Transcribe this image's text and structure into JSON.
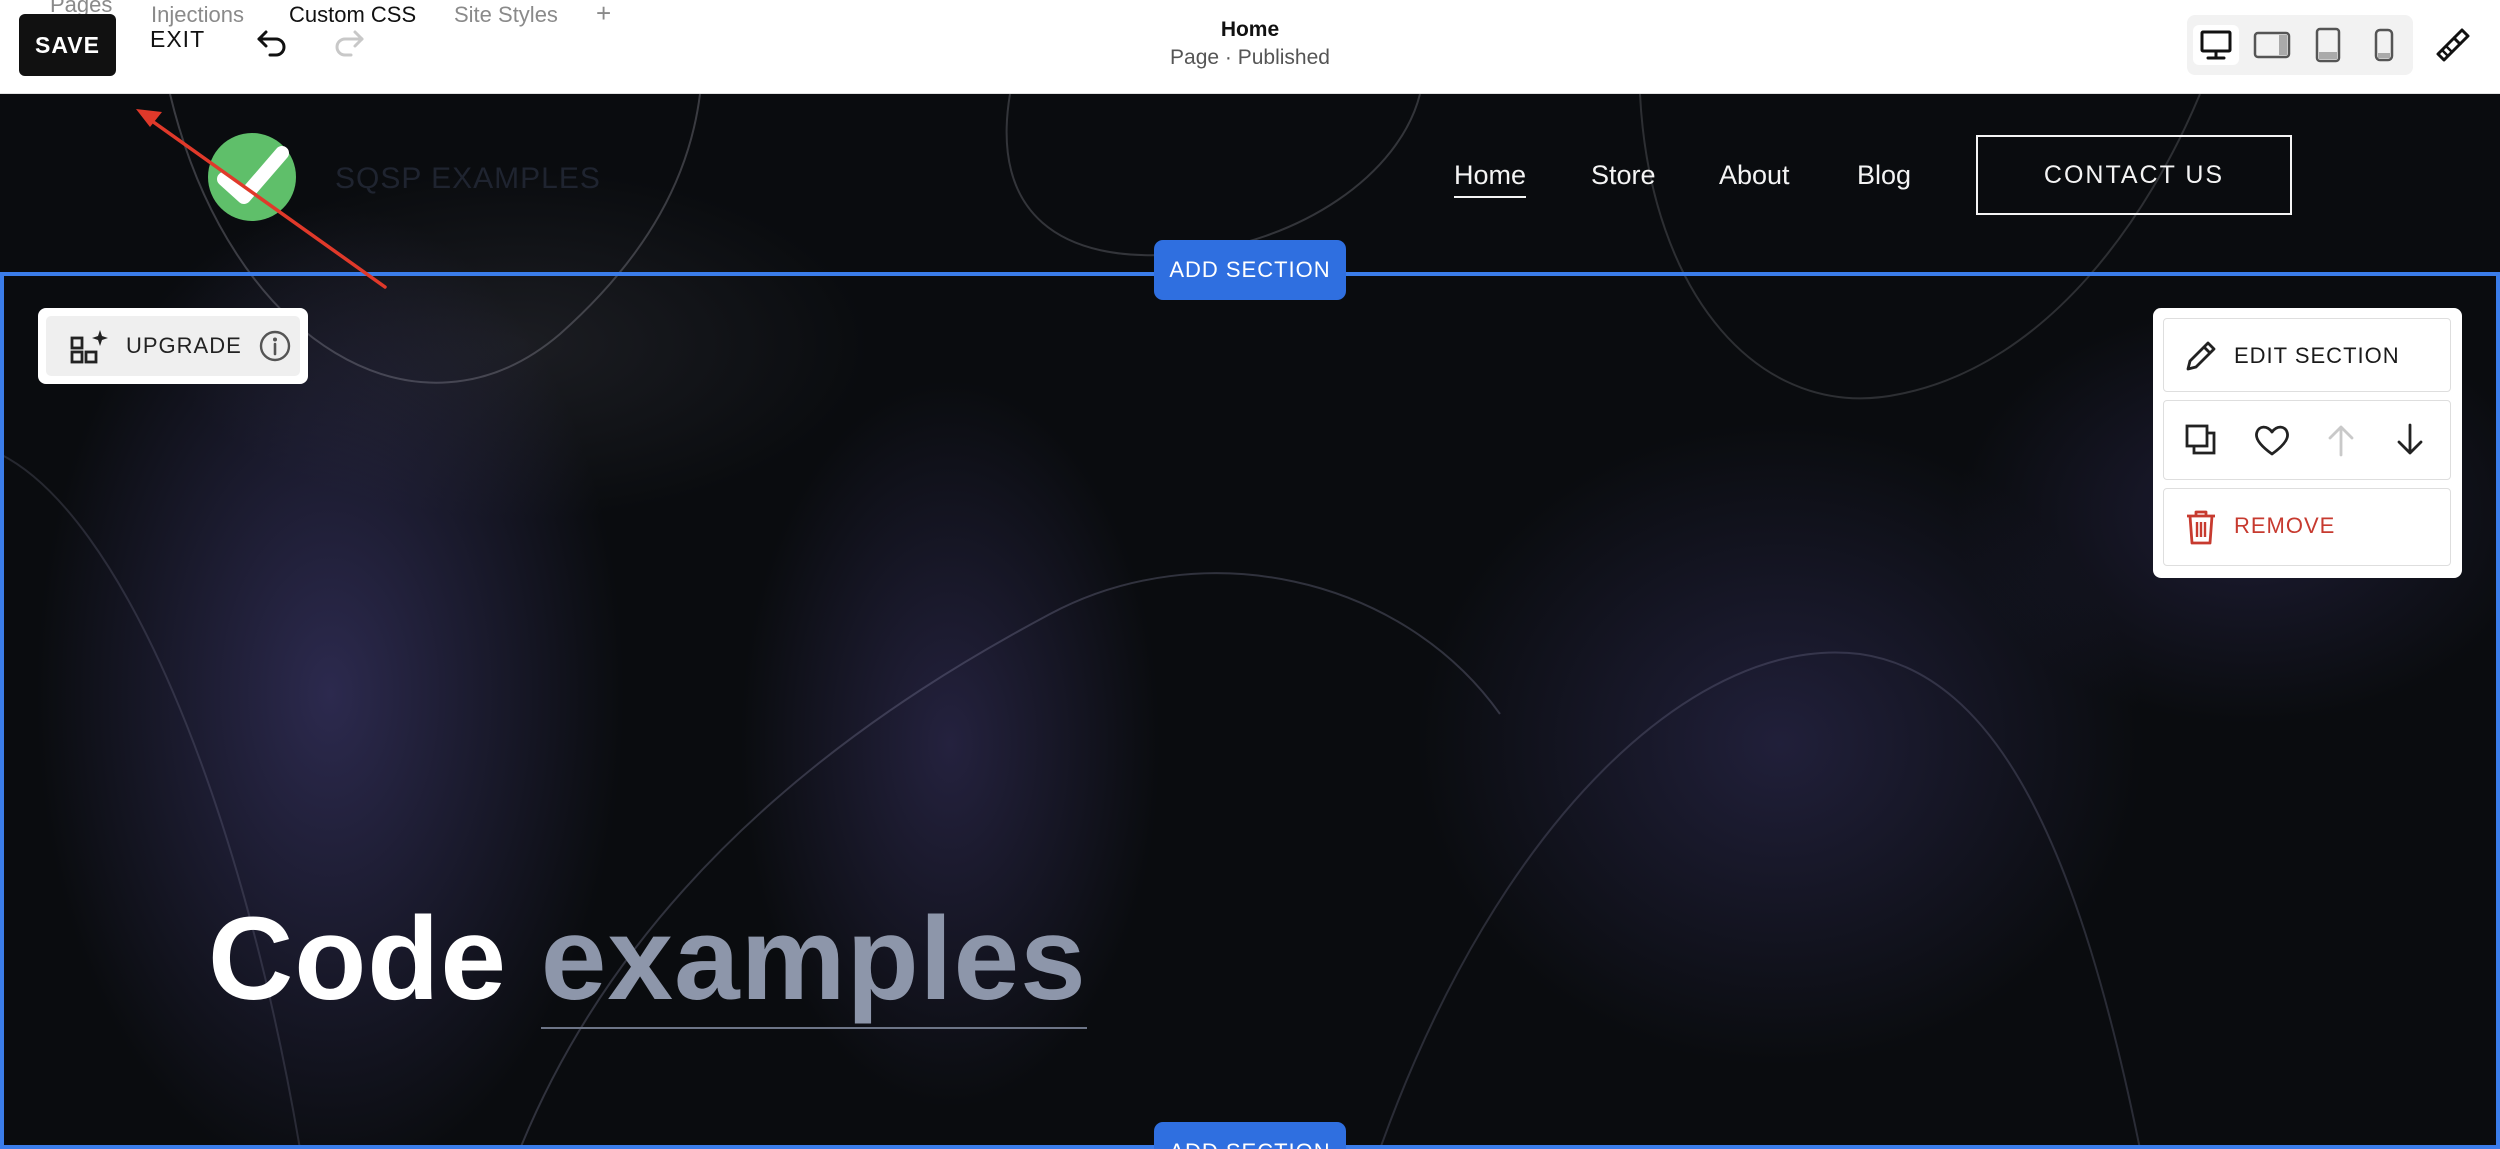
{
  "editor": {
    "tabs": [
      "Pages",
      "Injections",
      "Custom CSS",
      "Site Styles"
    ],
    "add_tab_label": "+",
    "save_label": "SAVE",
    "exit_label": "EXIT",
    "page_title": "Home",
    "page_status": "Page · Published",
    "device_views": [
      "desktop",
      "tablet-landscape",
      "tablet-portrait",
      "mobile"
    ],
    "active_device": "desktop"
  },
  "site": {
    "name": "SQSP EXAMPLES",
    "nav": [
      "Home",
      "Store",
      "About",
      "Blog"
    ],
    "active_nav": "Home",
    "cta_label": "CONTACT US"
  },
  "section": {
    "add_section_label": "ADD SECTION",
    "upgrade_label": "UPGRADE",
    "toolbar": {
      "edit_label": "EDIT SECTION",
      "remove_label": "REMOVE"
    },
    "heading_main": "Code",
    "heading_accent": "examples"
  },
  "colors": {
    "accent_blue": "#2f6fe0",
    "frame_blue": "#3b7dea",
    "logo_green": "#5fbf6a",
    "remove_red": "#c73a2f",
    "annotation_red": "#e0392a"
  }
}
